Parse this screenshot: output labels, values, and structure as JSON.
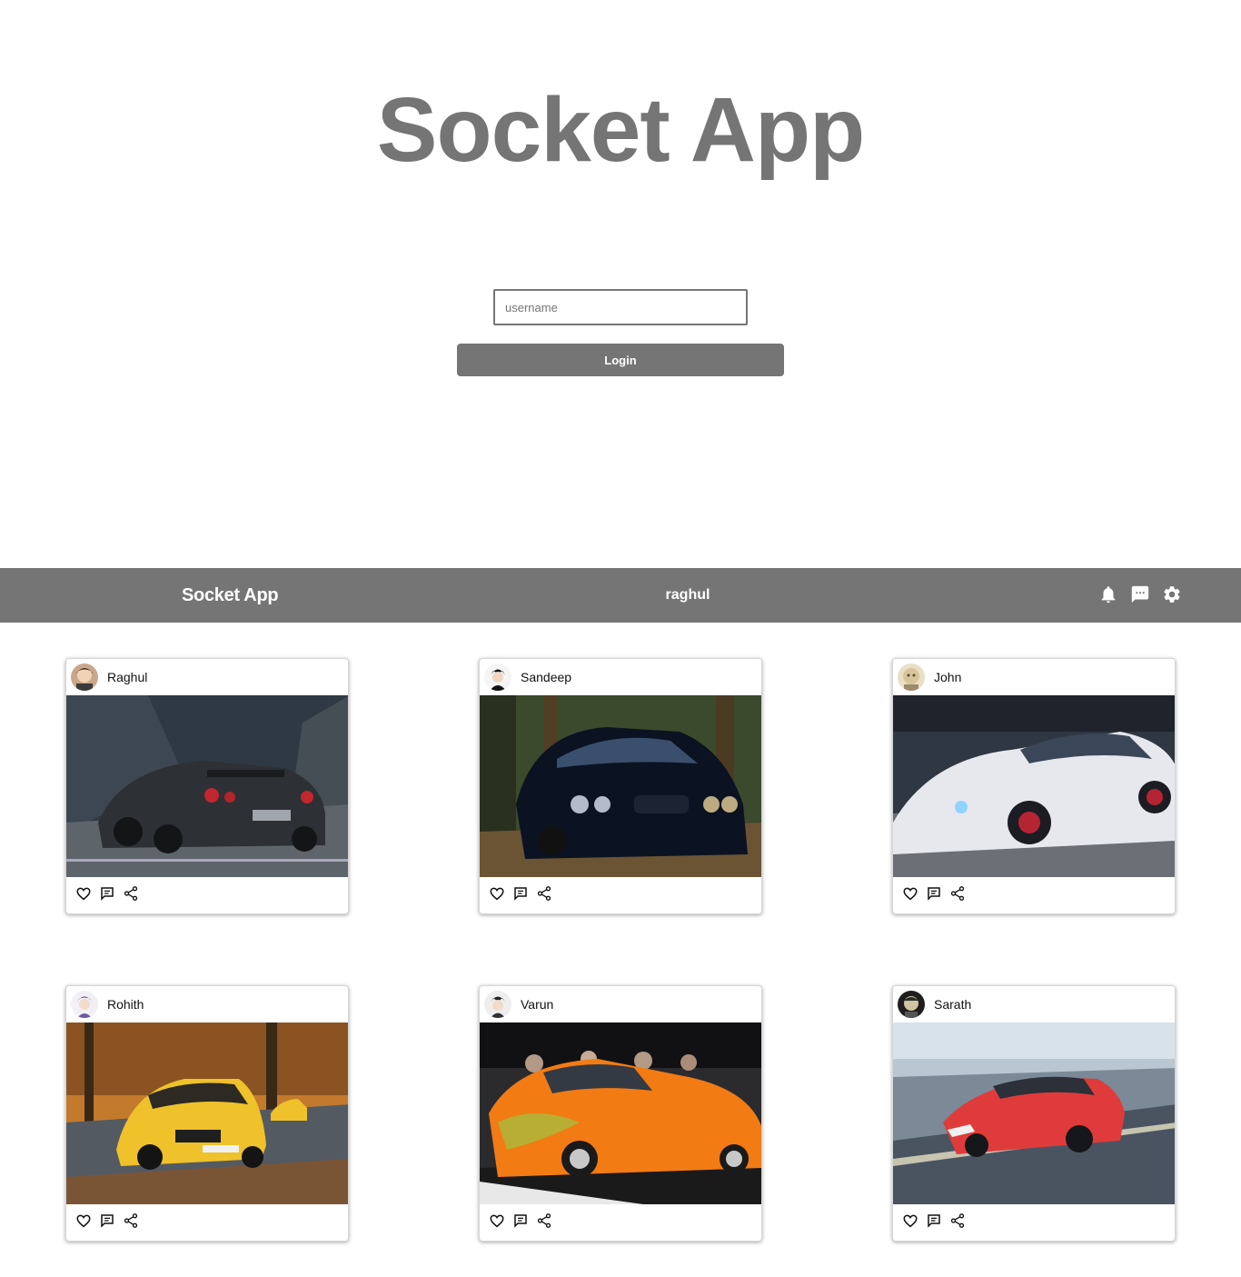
{
  "login": {
    "title": "Socket App",
    "username_placeholder": "username",
    "login_label": "Login"
  },
  "navbar": {
    "brand": "Socket App",
    "current_user": "raghul",
    "icons": [
      "bell-icon",
      "chat-icon",
      "gear-icon"
    ]
  },
  "posts": [
    {
      "user": "Raghul",
      "image": "dark grey sports car on mountain road",
      "actions": [
        "heart-icon",
        "comment-icon",
        "share-icon"
      ]
    },
    {
      "user": "Sandeep",
      "image": "black sedan in autumn forest",
      "actions": [
        "heart-icon",
        "comment-icon",
        "share-icon"
      ]
    },
    {
      "user": "John",
      "image": "white sports car on track",
      "actions": [
        "heart-icon",
        "comment-icon",
        "share-icon"
      ]
    },
    {
      "user": "Rohith",
      "image": "yellow muscle car on autumn road",
      "actions": [
        "heart-icon",
        "comment-icon",
        "share-icon"
      ]
    },
    {
      "user": "Varun",
      "image": "orange sports car at show",
      "actions": [
        "heart-icon",
        "comment-icon",
        "share-icon"
      ]
    },
    {
      "user": "Sarath",
      "image": "red supercar on coastal road",
      "actions": [
        "heart-icon",
        "comment-icon",
        "share-icon"
      ]
    }
  ],
  "colors": {
    "primary": "#757575",
    "background": "#ffffff",
    "text_on_primary": "#ffffff"
  }
}
